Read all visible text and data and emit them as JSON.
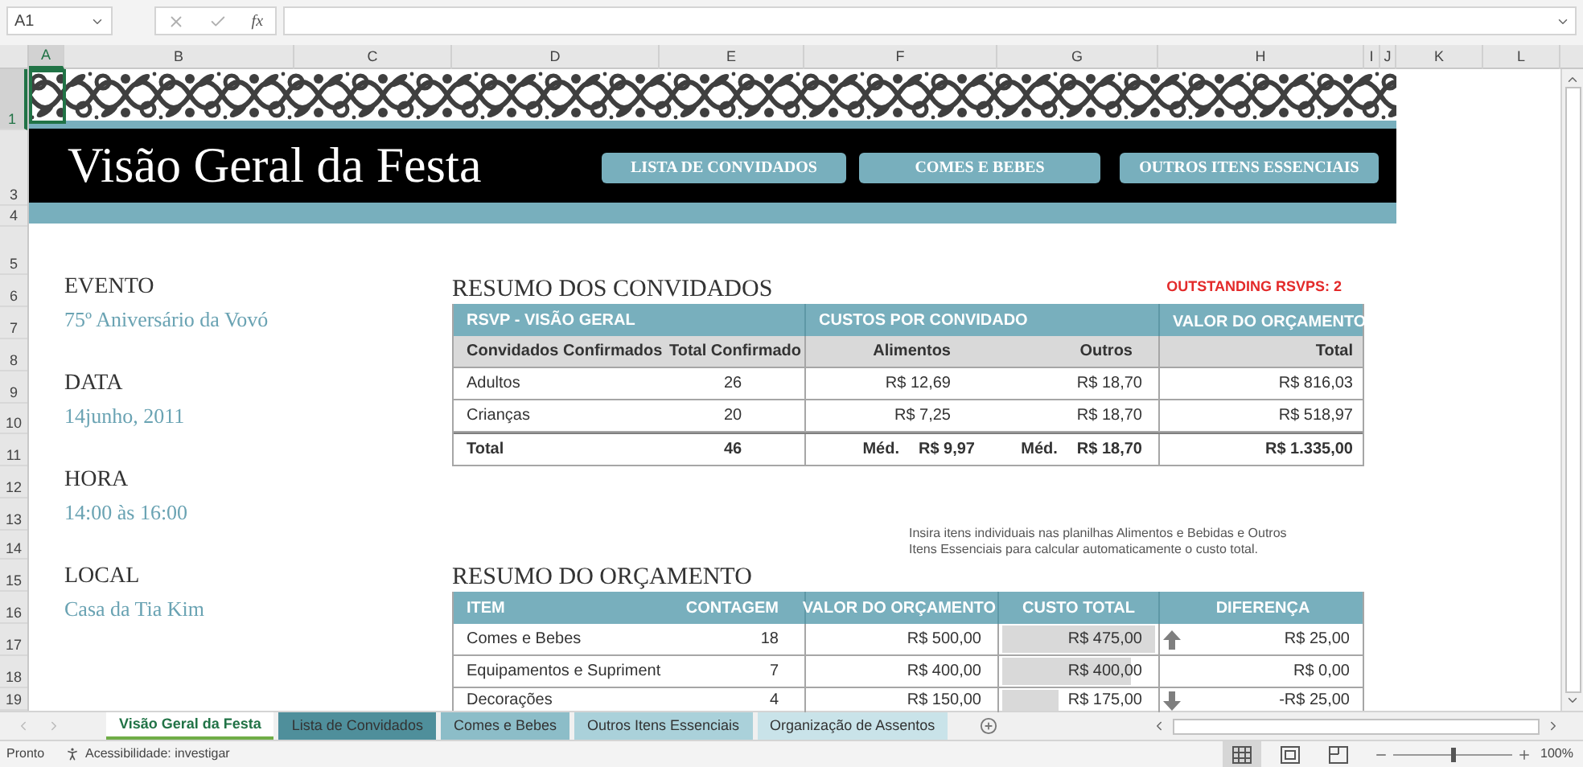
{
  "formula_bar": {
    "name_box": "A1",
    "function_label": "fx"
  },
  "column_headers": [
    {
      "label": "A",
      "selected": true
    },
    {
      "label": "B",
      "selected": false
    },
    {
      "label": "C",
      "selected": false
    },
    {
      "label": "D",
      "selected": false
    },
    {
      "label": "E",
      "selected": false
    },
    {
      "label": "F",
      "selected": false
    },
    {
      "label": "G",
      "selected": false
    },
    {
      "label": "H",
      "selected": false
    },
    {
      "label": "I",
      "selected": false
    },
    {
      "label": "J",
      "selected": false
    },
    {
      "label": "K",
      "selected": false
    },
    {
      "label": "L",
      "selected": false
    }
  ],
  "row_headers": [
    {
      "label": "1",
      "selected": true
    },
    {
      "label": "3",
      "selected": false
    },
    {
      "label": "4",
      "selected": false
    },
    {
      "label": "5",
      "selected": false
    },
    {
      "label": "6",
      "selected": false
    },
    {
      "label": "7",
      "selected": false
    },
    {
      "label": "8",
      "selected": false
    },
    {
      "label": "9",
      "selected": false
    },
    {
      "label": "10",
      "selected": false
    },
    {
      "label": "11",
      "selected": false
    },
    {
      "label": "12",
      "selected": false
    },
    {
      "label": "13",
      "selected": false
    },
    {
      "label": "14",
      "selected": false
    },
    {
      "label": "15",
      "selected": false
    },
    {
      "label": "16",
      "selected": false
    },
    {
      "label": "17",
      "selected": false
    },
    {
      "label": "18",
      "selected": false
    },
    {
      "label": "19",
      "selected": false
    }
  ],
  "banner": {
    "title": "Visão Geral da Festa",
    "buttons": [
      "LISTA DE CONVIDADOS",
      "COMES E BEBES",
      "OUTROS ITENS ESSENCIAIS"
    ]
  },
  "event_details": [
    {
      "label": "EVENTO",
      "value": "75º Aniversário da Vovó"
    },
    {
      "label": "DATA",
      "value": "14junho, 2011"
    },
    {
      "label": "HORA",
      "value": "14:00 às 16:00"
    },
    {
      "label": "LOCAL",
      "value": "Casa da Tia Kim"
    }
  ],
  "guest_summary": {
    "title": "RESUMO DOS CONVIDADOS",
    "alert": "OUTSTANDING RSVPS: 2",
    "group_headers": [
      "RSVP - VISÃO GERAL",
      "CUSTOS POR CONVIDADO",
      "VALOR DO ORÇAMENTO"
    ],
    "columns": [
      "Convidados Confirmados",
      "Total Confirmado",
      "Alimentos",
      "Outros",
      "Total"
    ],
    "rows": [
      {
        "name": "Adultos",
        "confirmed": "26",
        "food": "R$ 12,69",
        "other": "R$ 18,70",
        "total": "R$ 816,03"
      },
      {
        "name": "Crianças",
        "confirmed": "20",
        "food": "R$ 7,25",
        "other": "R$ 18,70",
        "total": "R$ 518,97"
      }
    ],
    "total_row": {
      "label": "Total",
      "confirmed": "46",
      "food_prefix": "Méd.",
      "food": "R$ 9,97",
      "other_prefix": "Méd.",
      "other": "R$ 18,70",
      "total": "R$ 1.335,00"
    }
  },
  "budget_note": "Insira itens individuais nas planilhas Alimentos e Bebidas e Outros Itens Essenciais para calcular automaticamente o custo total.",
  "budget_summary": {
    "title": "RESUMO DO ORÇAMENTO",
    "columns": [
      "ITEM",
      "CONTAGEM",
      "VALOR DO ORÇAMENTO",
      "CUSTO TOTAL",
      "DIFERENÇA"
    ],
    "rows": [
      {
        "item": "Comes e Bebes",
        "count": "18",
        "budget": "R$ 500,00",
        "cost": "R$ 475,00",
        "level": 1,
        "kind": "up",
        "difference": "R$ 25,00"
      },
      {
        "item": "Equipamentos e Supriment",
        "count": "7",
        "budget": "R$ 400,00",
        "cost": "R$ 400,00",
        "level": 0.84,
        "kind": "none",
        "difference": "R$ 0,00"
      },
      {
        "item": "Decorações",
        "count": "4",
        "budget": "R$ 150,00",
        "cost": "R$ 175,00",
        "level": 0.37,
        "kind": "down",
        "difference": "-R$ 25,00"
      }
    ]
  },
  "sheet_tabs": [
    {
      "label": "Visão Geral da Festa",
      "selected": true,
      "color": "#70ad47"
    },
    {
      "label": "Lista de Convidados",
      "selected": false,
      "color": "#4f8f9b"
    },
    {
      "label": "Comes e Bebes",
      "selected": false,
      "color": "#8cbdc8"
    },
    {
      "label": "Outros Itens Essenciais",
      "selected": false,
      "color": "#aad1da"
    },
    {
      "label": "Organização de Assentos",
      "selected": false,
      "color": "#c9e3e9"
    }
  ],
  "status_bar": {
    "status": "Pronto",
    "accessibility": "Acessibilidade: investigar",
    "views": [
      {
        "kind": "normal",
        "selected": true
      },
      {
        "kind": "page_layout",
        "selected": false
      },
      {
        "kind": "page_break",
        "selected": false
      }
    ],
    "zoom": {
      "level": 0.5,
      "label": "100%"
    }
  }
}
